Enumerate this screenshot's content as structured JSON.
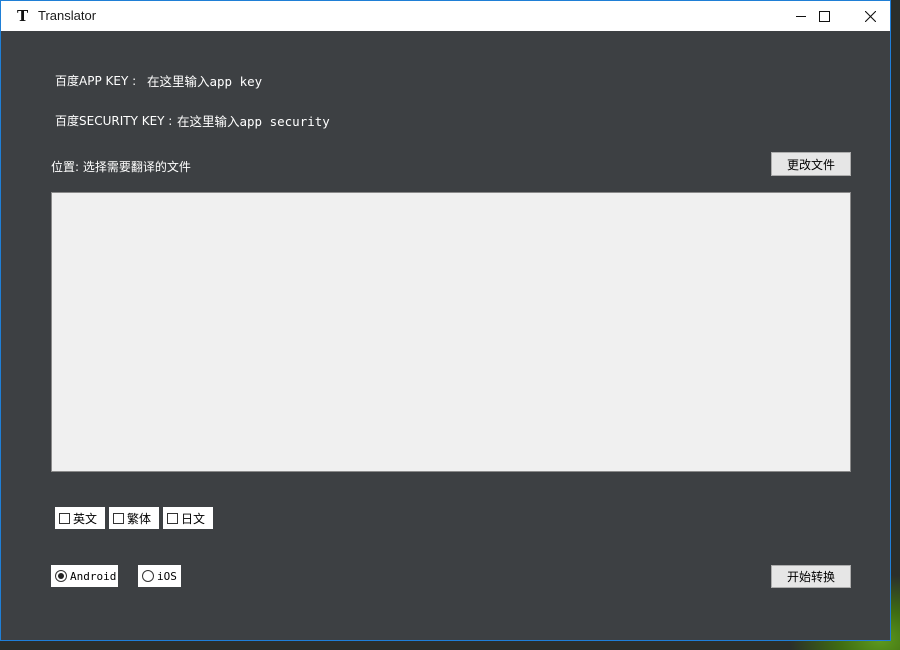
{
  "window": {
    "title": "Translator",
    "icon": "t-logo-icon"
  },
  "form": {
    "app_key_label": "百度APP KEY :",
    "app_key_value": "在这里输入app key",
    "security_key_label": "百度SECURITY KEY :",
    "security_key_value": "在这里输入app security",
    "location_label": "位置: 选择需要翻译的文件",
    "change_file_button": "更改文件",
    "text_area_value": ""
  },
  "languages": [
    {
      "label": "英文",
      "checked": false
    },
    {
      "label": "繁体",
      "checked": false
    },
    {
      "label": "日文",
      "checked": false
    }
  ],
  "platforms": [
    {
      "label": "Android",
      "selected": true
    },
    {
      "label": "iOS",
      "selected": false
    }
  ],
  "start_button": "开始转换",
  "colors": {
    "window_bg": "#3d4043",
    "titlebar_bg": "#ffffff",
    "border_accent": "#1f7fd6"
  }
}
